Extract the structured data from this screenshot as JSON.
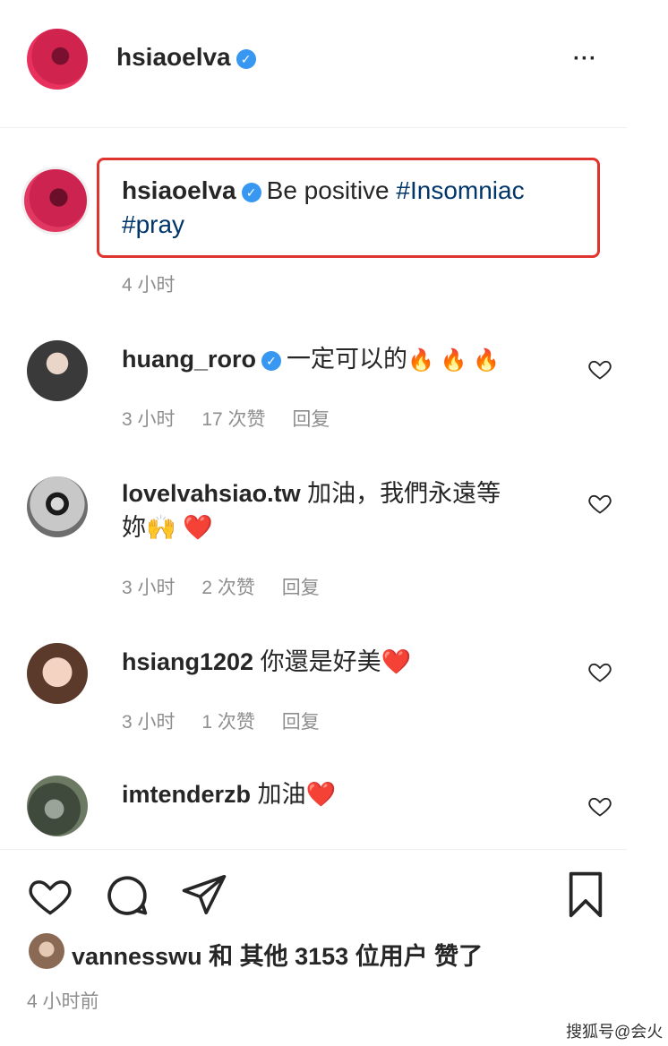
{
  "header": {
    "username": "hsiaoelva",
    "more_icon": "more-horizontal-icon"
  },
  "caption": {
    "username": "hsiaoelva",
    "text": "Be positive",
    "tag1": "#Insomniac",
    "tag2": "#pray",
    "time": "4 小时"
  },
  "comments": [
    {
      "username": "huang_roro",
      "verified": true,
      "text": "一定可以的",
      "emoji": "🔥 🔥 🔥",
      "time": "3 小时",
      "likes": "17 次赞",
      "reply": "回复"
    },
    {
      "username": "lovelvahsiao.tw",
      "text_line1": "加油，我們永遠等",
      "text_line2": "妳",
      "emoji": "🙌 ❤️",
      "time": "3 小时",
      "likes": "2 次赞",
      "reply": "回复"
    },
    {
      "username": "hsiang1202",
      "text": "你還是好美",
      "emoji": "❤️",
      "time": "3 小时",
      "likes": "1 次赞",
      "reply": "回复"
    },
    {
      "username": "imtenderzb",
      "text": "加油",
      "emoji": "❤️"
    }
  ],
  "likes_line": {
    "username": "vannesswu",
    "text": "和 其他 3153 位用户 赞了"
  },
  "post_time": "4 小时前",
  "watermark": "搜狐号@会火",
  "colors": {
    "highlight_border": "#e0342f",
    "verified_blue": "#3897f0",
    "hashtag": "#003569",
    "meta_gray": "#8e8e8e"
  }
}
